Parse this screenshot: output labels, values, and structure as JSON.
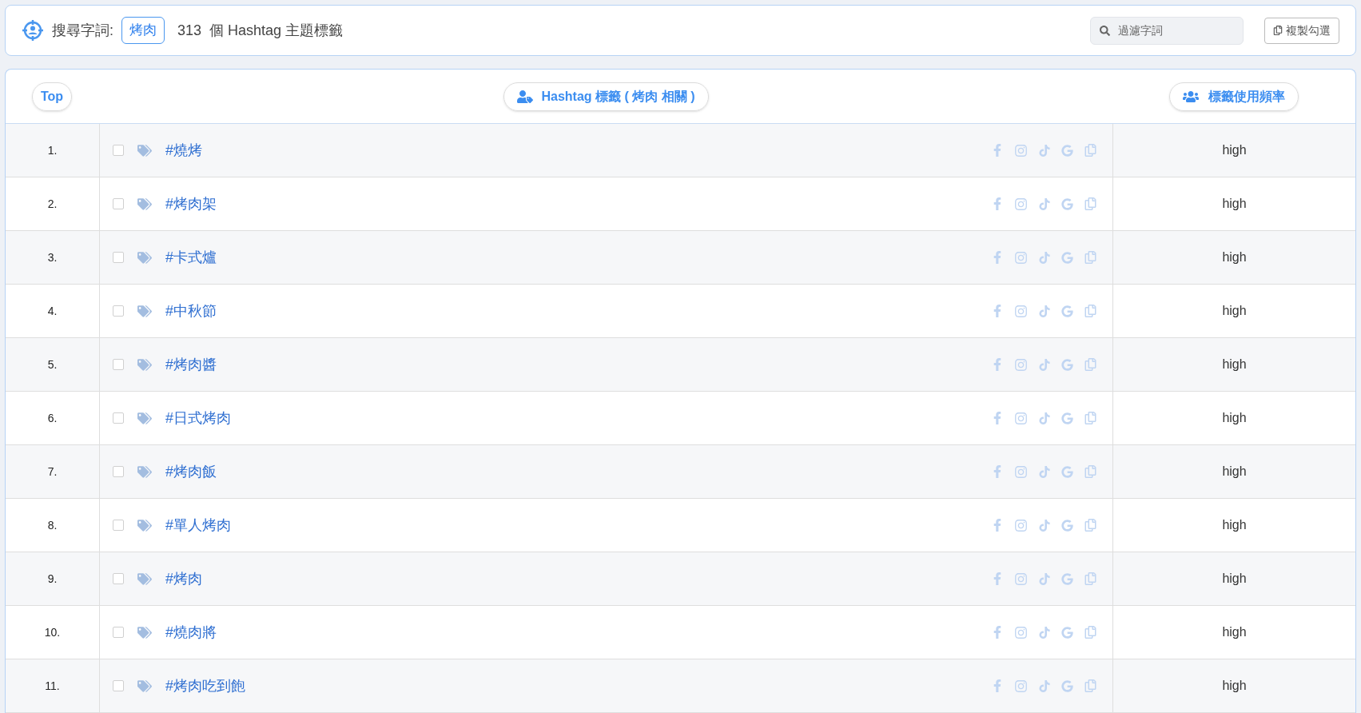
{
  "search_bar": {
    "label": "搜尋字詞:",
    "keyword": "烤肉",
    "count_text": "313  個 Hashtag 主題標籤",
    "filter": {
      "placeholder": "過濾字詞"
    },
    "copy_button": "複製勾選"
  },
  "table": {
    "columns": [
      "Top",
      "Hashtag 標籤 ( 烤肉 相關 )",
      "標籤使用頻率"
    ],
    "rows": [
      {
        "rank": "1.",
        "tag": "#燒烤",
        "checked": false,
        "frequency": "high"
      },
      {
        "rank": "2.",
        "tag": "#烤肉架",
        "checked": false,
        "frequency": "high"
      },
      {
        "rank": "3.",
        "tag": "#卡式爐",
        "checked": false,
        "frequency": "high"
      },
      {
        "rank": "4.",
        "tag": "#中秋節",
        "checked": false,
        "frequency": "high"
      },
      {
        "rank": "5.",
        "tag": "#烤肉醬",
        "checked": false,
        "frequency": "high"
      },
      {
        "rank": "6.",
        "tag": "#日式烤肉",
        "checked": false,
        "frequency": "high"
      },
      {
        "rank": "7.",
        "tag": "#烤肉飯",
        "checked": false,
        "frequency": "high"
      },
      {
        "rank": "8.",
        "tag": "#單人烤肉",
        "checked": false,
        "frequency": "high"
      },
      {
        "rank": "9.",
        "tag": "#烤肉",
        "checked": false,
        "frequency": "high"
      },
      {
        "rank": "10.",
        "tag": "#燒肉將",
        "checked": false,
        "frequency": "high"
      },
      {
        "rank": "11.",
        "tag": "#烤肉吃到飽",
        "checked": false,
        "frequency": "high"
      }
    ]
  }
}
